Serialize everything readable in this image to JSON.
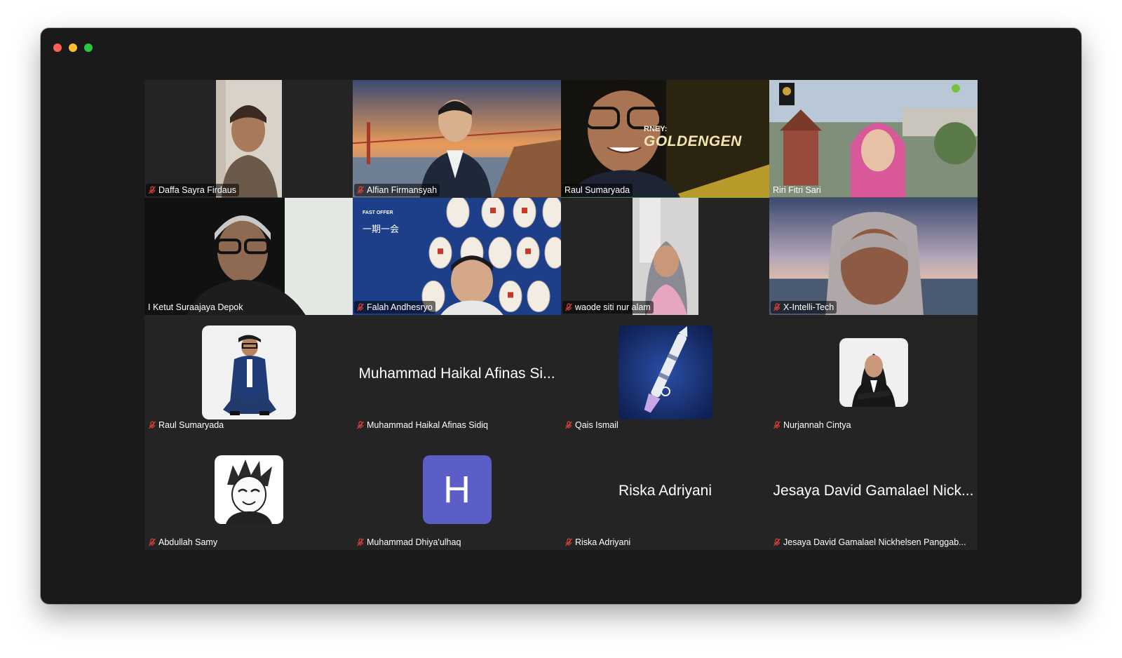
{
  "window": {
    "controls": [
      "close",
      "minimize",
      "zoom"
    ]
  },
  "participants": [
    {
      "name": "Daffa Sayra Firdaus",
      "muted": true
    },
    {
      "name": "Alfian Firmansyah",
      "muted": true
    },
    {
      "name": "Raul Sumaryada",
      "muted": false,
      "active_speaker": true,
      "background_text": "RNEY: GOLDENGEN"
    },
    {
      "name": "Riri Fitri Sari",
      "muted": false
    },
    {
      "name": "I Ketut Suraajaya Depok",
      "muted": false
    },
    {
      "name": "Falah Andhesryo",
      "muted": true,
      "background_text": "一期一会",
      "background_brand": "FAST OFFER"
    },
    {
      "name": "waode siti nur alam",
      "muted": true
    },
    {
      "name": "X-Intelli-Tech",
      "muted": true
    },
    {
      "name": "Raul Sumaryada",
      "muted": true
    },
    {
      "name": "Muhammad Haikal Afinas Sidiq",
      "display": "Muhammad Haikal Afinas Si...",
      "muted": true
    },
    {
      "name": "Qais Ismail",
      "muted": true
    },
    {
      "name": "Nurjannah Cintya",
      "muted": true
    },
    {
      "name": "Abdullah Samy",
      "muted": true
    },
    {
      "name": "Muhammad Dhiya'ulhaq",
      "avatar_letter": "H",
      "muted": true
    },
    {
      "name": "Riska Adriyani",
      "display": "Riska Adriyani",
      "muted": true
    },
    {
      "name": "Jesaya David Gamalael Nickhelsen Panggab...",
      "display": "Jesaya David Gamalael Nick...",
      "muted": true
    }
  ],
  "colors": {
    "window_bg": "#1a1a1a",
    "tile_bg": "#242424",
    "active_border": "#5fd35f",
    "mute_icon": "#e0413a",
    "letter_avatar_bg": "#5a5ec6"
  },
  "icons": [
    "microphone-muted-icon"
  ]
}
